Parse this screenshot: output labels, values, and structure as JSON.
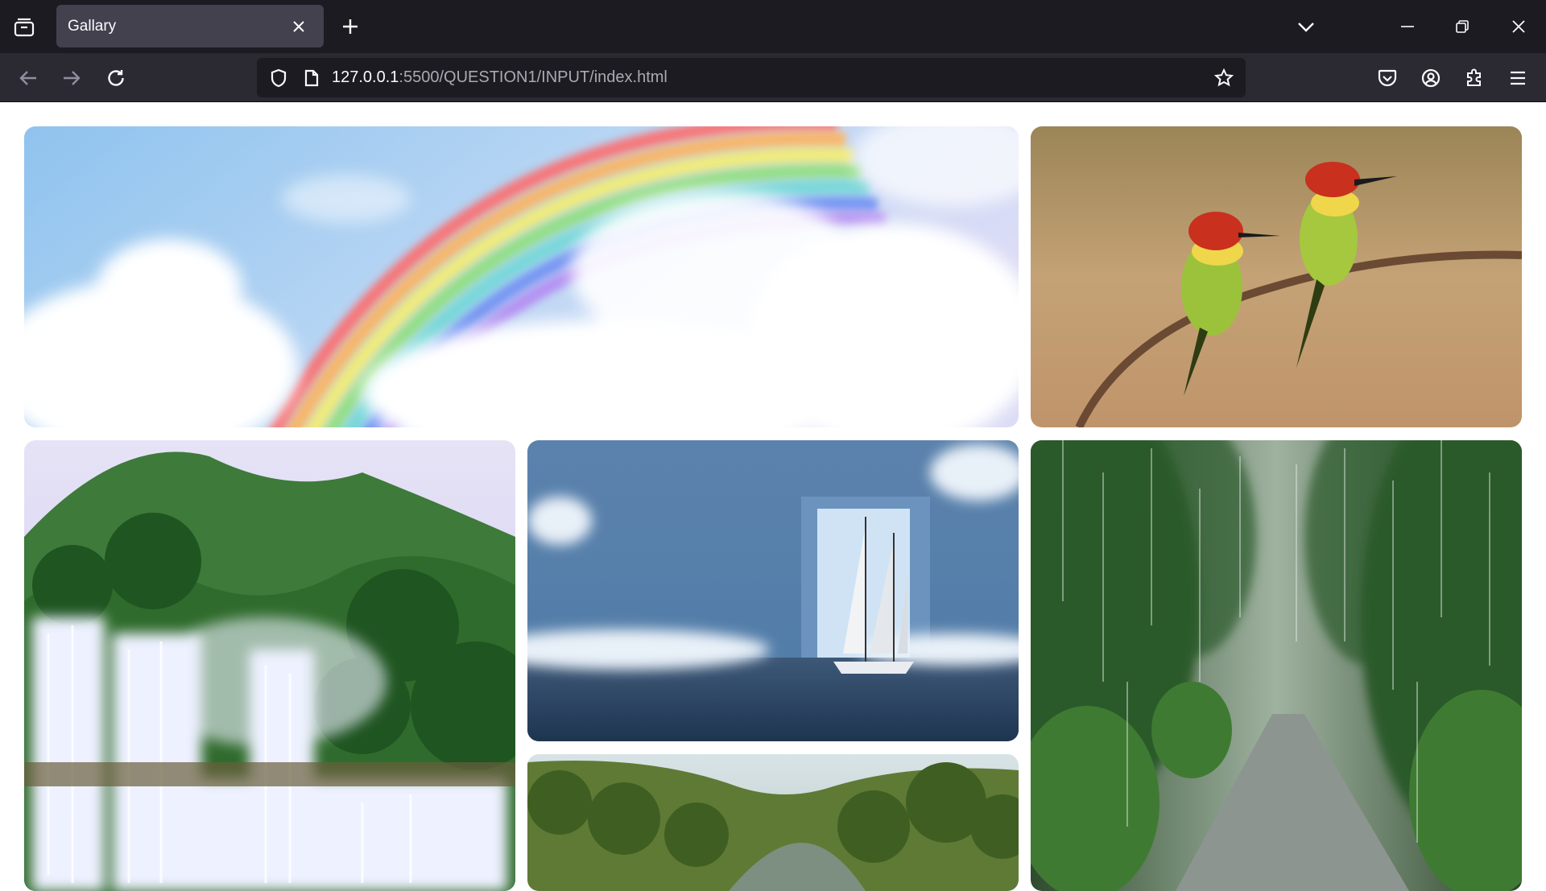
{
  "browser": {
    "tab": {
      "title": "Gallary"
    },
    "url": {
      "host": "127.0.0.1",
      "rest": ":5500/QUESTION1/INPUT/index.html"
    },
    "icons": {
      "tab_overview": "tab-overview-icon",
      "close_tab": "close-icon",
      "new_tab": "plus-icon",
      "list_all_tabs": "chevron-down-icon",
      "minimize": "minimize-icon",
      "restore": "restore-icon",
      "close_window": "close-icon",
      "back": "arrow-left-icon",
      "forward": "arrow-right-icon",
      "reload": "reload-icon",
      "tracking_protection": "shield-icon",
      "page_info": "page-icon",
      "bookmark": "star-icon",
      "pocket": "pocket-icon",
      "account": "account-icon",
      "extensions": "puzzle-icon",
      "menu": "hamburger-icon"
    }
  },
  "gallery": {
    "images": [
      {
        "subject": "rainbow"
      },
      {
        "subject": "birds"
      },
      {
        "subject": "waterfall"
      },
      {
        "subject": "sailboat"
      },
      {
        "subject": "rainy-road"
      },
      {
        "subject": "forest-river"
      }
    ]
  },
  "colors": {
    "chrome_dark": "#1c1b22",
    "chrome_toolbar": "#2b2a33",
    "tab_active": "#42414d",
    "url_dim": "#a9a9b3"
  }
}
